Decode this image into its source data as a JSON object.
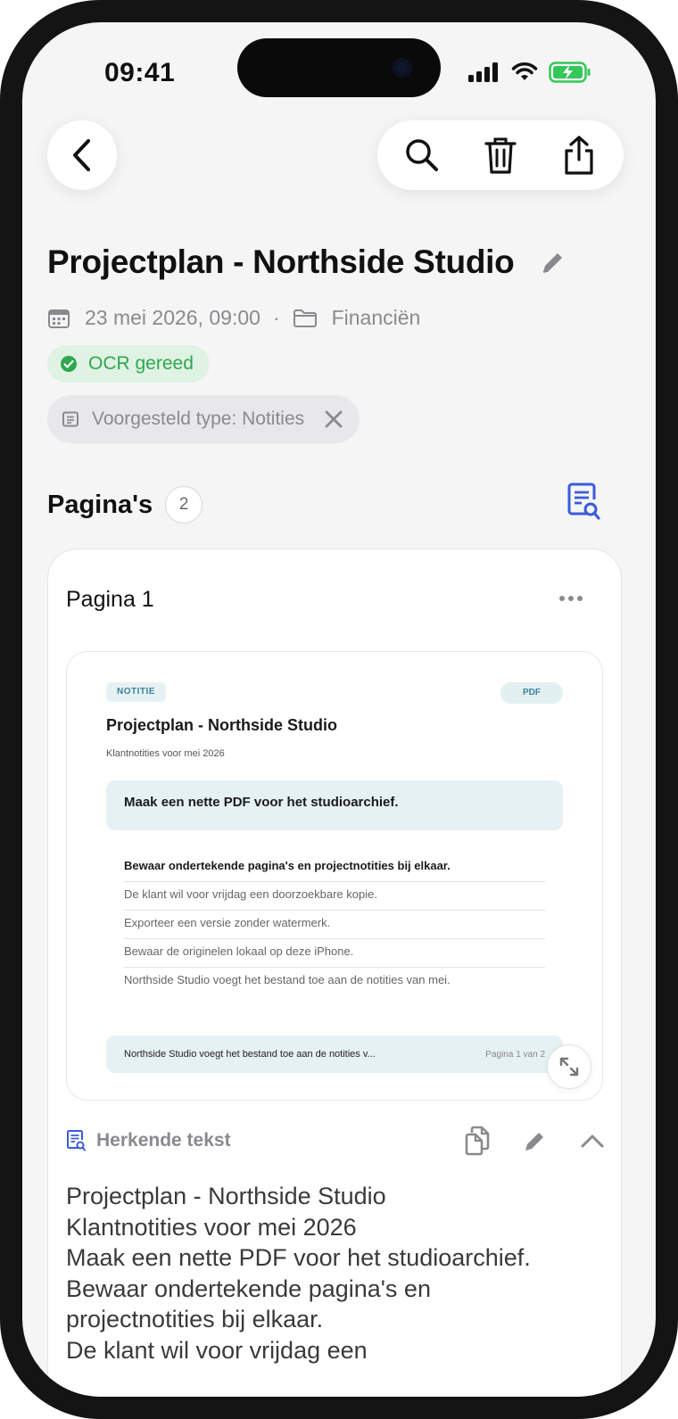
{
  "status_bar": {
    "time": "09:41"
  },
  "document": {
    "title": "Projectplan - Northside Studio",
    "date": "23 mei 2026, 09:00",
    "separator": "·",
    "folder": "Financiën",
    "ocr_status": "OCR gereed",
    "suggested_type": "Voorgesteld type: Notities"
  },
  "pages": {
    "heading": "Pagina's",
    "count": "2",
    "card": {
      "title": "Pagina 1",
      "preview": {
        "tag": "NOTITIE",
        "format": "PDF",
        "title": "Projectplan - Northside Studio",
        "subtitle": "Klantnotities voor mei 2026",
        "highlight": "Maak een nette PDF voor het studioarchief.",
        "list": [
          "Bewaar ondertekende pagina's en projectnotities bij elkaar.",
          "De klant wil voor vrijdag een doorzoekbare kopie.",
          "Exporteer een versie zonder watermerk.",
          "Bewaar de originelen lokaal op deze iPhone.",
          "Northside Studio voegt het bestand toe aan de notities van mei."
        ],
        "footer_text": "Northside Studio voegt het bestand toe aan de notities v...",
        "footer_page": "Pagina 1 van 2"
      },
      "ocr_label": "Herkende tekst",
      "ocr_lines": [
        "Projectplan - Northside Studio",
        "Klantnotities voor mei 2026",
        "Maak een nette PDF voor het studioarchief.",
        "Bewaar ondertekende pagina's en",
        "projectnotities bij elkaar.",
        "De klant wil voor vrijdag een"
      ]
    }
  },
  "colors": {
    "accent": "#3b5bdb",
    "ocr_green": "#2fa84f",
    "battery_green": "#34c759"
  },
  "icons": [
    "back-icon",
    "search-icon",
    "trash-icon",
    "share-icon",
    "pencil-icon",
    "calendar-icon",
    "folder-icon",
    "check-circle-icon",
    "document-icon",
    "close-icon",
    "document-search-icon",
    "more-icon",
    "expand-icon",
    "copy-icon",
    "chevron-up-icon"
  ]
}
